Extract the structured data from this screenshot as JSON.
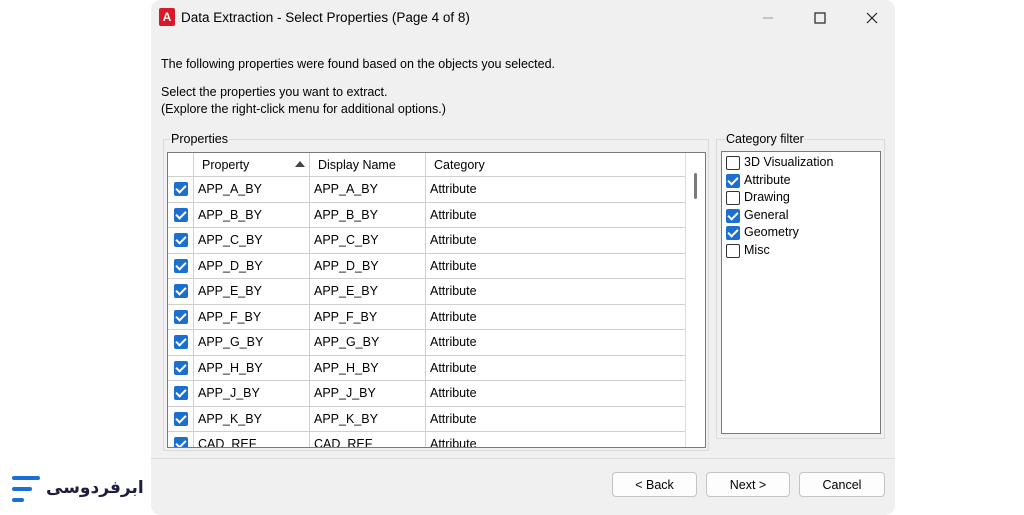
{
  "window": {
    "title": "Data Extraction - Select Properties (Page 4 of 8)",
    "app_icon_letter": "A"
  },
  "intro": {
    "line1": "The following properties were found based on the objects you selected.",
    "line2": "Select the properties you want to extract.",
    "line3": "(Explore the right-click menu for additional options.)"
  },
  "properties": {
    "group_label": "Properties",
    "columns": [
      "Property",
      "Display Name",
      "Category"
    ],
    "rows": [
      {
        "checked": true,
        "property": "APP_A_BY",
        "display_name": "APP_A_BY",
        "category": "Attribute"
      },
      {
        "checked": true,
        "property": "APP_B_BY",
        "display_name": "APP_B_BY",
        "category": "Attribute"
      },
      {
        "checked": true,
        "property": "APP_C_BY",
        "display_name": "APP_C_BY",
        "category": "Attribute"
      },
      {
        "checked": true,
        "property": "APP_D_BY",
        "display_name": "APP_D_BY",
        "category": "Attribute"
      },
      {
        "checked": true,
        "property": "APP_E_BY",
        "display_name": "APP_E_BY",
        "category": "Attribute"
      },
      {
        "checked": true,
        "property": "APP_F_BY",
        "display_name": "APP_F_BY",
        "category": "Attribute"
      },
      {
        "checked": true,
        "property": "APP_G_BY",
        "display_name": "APP_G_BY",
        "category": "Attribute"
      },
      {
        "checked": true,
        "property": "APP_H_BY",
        "display_name": "APP_H_BY",
        "category": "Attribute"
      },
      {
        "checked": true,
        "property": "APP_J_BY",
        "display_name": "APP_J_BY",
        "category": "Attribute"
      },
      {
        "checked": true,
        "property": "APP_K_BY",
        "display_name": "APP_K_BY",
        "category": "Attribute"
      },
      {
        "checked": true,
        "property": "CAD_REF",
        "display_name": "CAD_REF",
        "category": "Attribute"
      }
    ]
  },
  "category_filter": {
    "group_label": "Category filter",
    "items": [
      {
        "label": "3D Visualization",
        "checked": false
      },
      {
        "label": "Attribute",
        "checked": true
      },
      {
        "label": "Drawing",
        "checked": false
      },
      {
        "label": "General",
        "checked": true
      },
      {
        "label": "Geometry",
        "checked": true
      },
      {
        "label": "Misc",
        "checked": false
      }
    ]
  },
  "buttons": {
    "back": "< Back",
    "next": "Next >",
    "cancel": "Cancel"
  },
  "watermark": {
    "text": "ابرفردوسی"
  },
  "colors": {
    "accent": "#1b6fd1",
    "app_icon": "#d7192a"
  }
}
